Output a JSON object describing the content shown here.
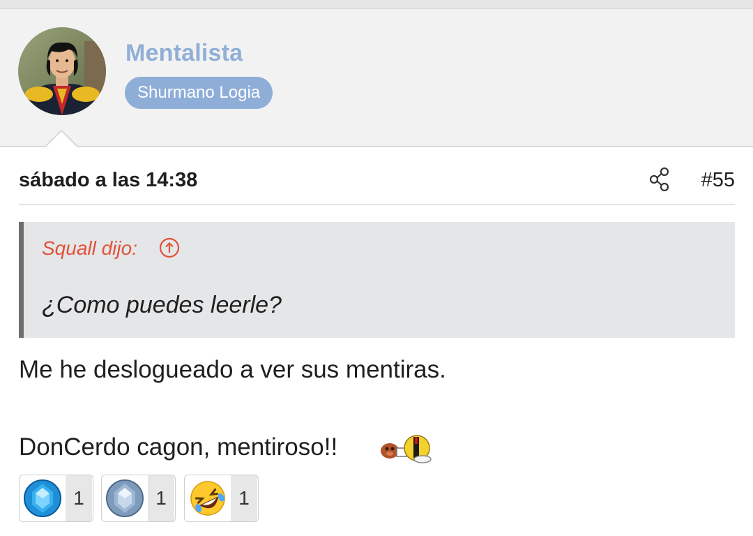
{
  "user": {
    "name": "Mentalista",
    "title": "Shurmano Logia"
  },
  "post": {
    "date": "sábado a las 14:38",
    "number": "#55",
    "quote": {
      "author": "Squall dijo:",
      "text": "¿Como puedes leerle?"
    },
    "lines": [
      "Me he deslogueado a ver sus mentiras.",
      "DonCerdo cagon, mentiroso!!"
    ]
  },
  "reactions": [
    {
      "icon": "blue-diamond-icon",
      "count": "1"
    },
    {
      "icon": "silver-diamond-icon",
      "count": "1"
    },
    {
      "icon": "rofl-emoji-icon",
      "count": "1"
    }
  ],
  "colors": {
    "username": "#8fafd6",
    "title_badge": "#8eaed8",
    "quote_author": "#e0533a",
    "quote_bg": "#e5e6e8"
  }
}
